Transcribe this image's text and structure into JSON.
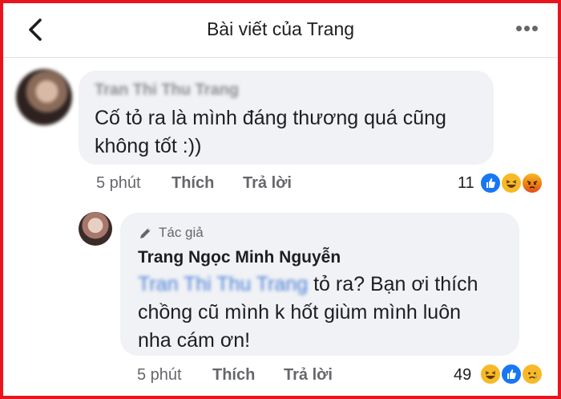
{
  "header": {
    "back_icon": "chevron-left-icon",
    "title": "Bài viết của Trang",
    "more_icon": "more-horizontal-icon"
  },
  "comment1": {
    "author": "Tran Thi Thu Trang",
    "text_line1": "Cố tỏ ra là mình đáng thương quá cũng",
    "text_line2": "không tốt :))",
    "time": "5 phút",
    "like": "Thích",
    "reply": "Trả lời",
    "reaction_count": "11",
    "reactions": [
      "like",
      "haha",
      "angry"
    ]
  },
  "comment2": {
    "author_badge": "Tác giả",
    "author": "Trang Ngọc Minh Nguyễn",
    "mention": "Tran Thi Thu Trang",
    "text_line1_rest": " tỏ ra? Bạn ơi thích",
    "text_line2": "chồng cũ mình k hốt giùm mình luôn",
    "text_line3": "nha cám ơn!",
    "time": "5 phút",
    "like": "Thích",
    "reply": "Trả lời",
    "reaction_count": "49",
    "reactions": [
      "haha",
      "like",
      "sad"
    ]
  },
  "colors": {
    "frame": "#e8161c",
    "bubble": "#f0f2f5",
    "like_blue": "#1877f2",
    "mention_blue": "#4b7fd8"
  }
}
